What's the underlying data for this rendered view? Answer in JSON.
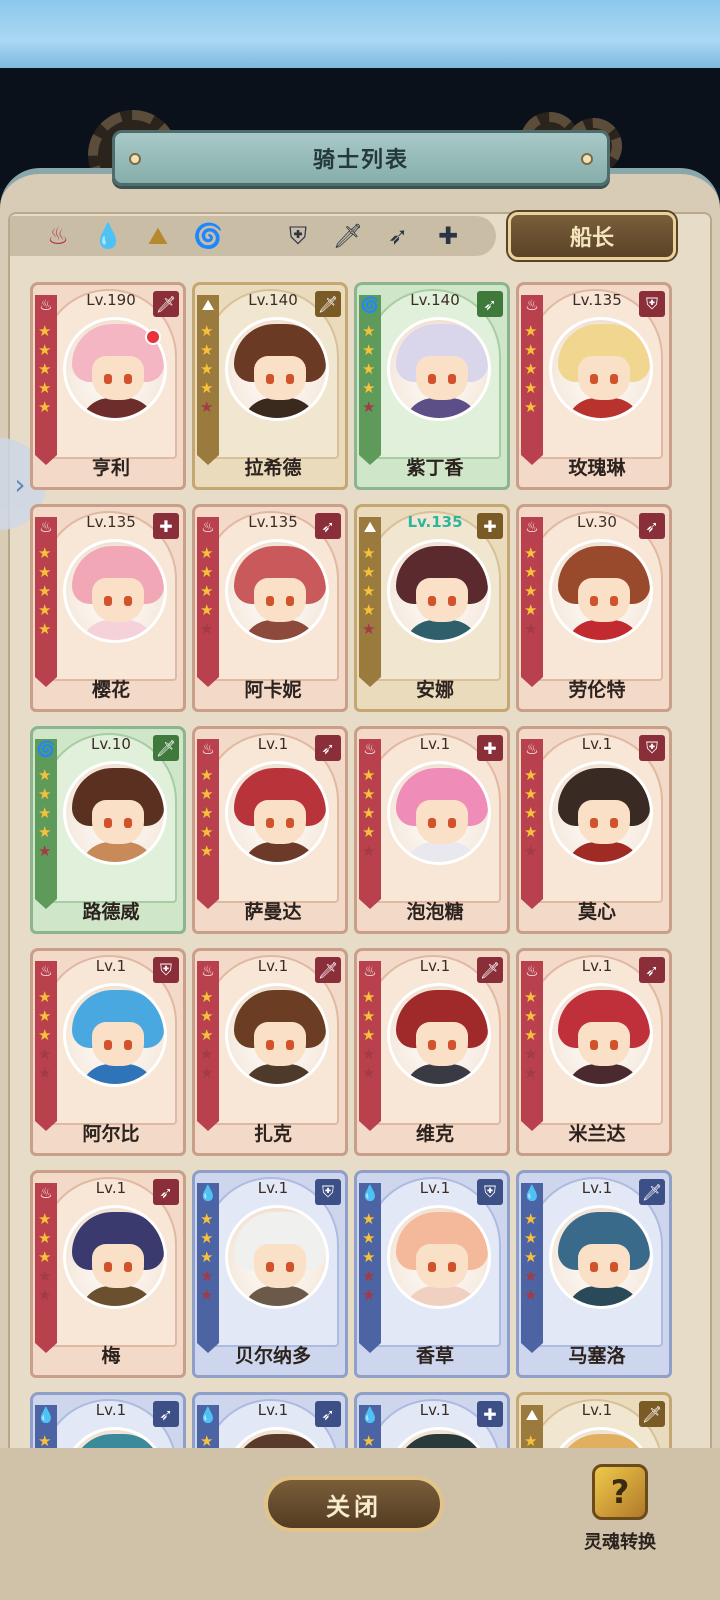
{
  "title": "骑士列表",
  "captain_label": "船长",
  "close_label": "关闭",
  "soul_label": "灵魂转换",
  "filters": {
    "elements": [
      {
        "name": "fire",
        "icon": "fire-icon",
        "glyph": "♨",
        "color": "#b0324a"
      },
      {
        "name": "water",
        "icon": "water-drop-icon",
        "glyph": "💧",
        "color": "#3c6fb5"
      },
      {
        "name": "earth",
        "icon": "earth-icon",
        "glyph": "⛰",
        "color": "#b58a2e"
      },
      {
        "name": "wind",
        "icon": "wind-icon",
        "glyph": "🌀",
        "color": "#7fae3a"
      }
    ],
    "classes": [
      {
        "name": "shield",
        "icon": "shield-icon",
        "glyph": "⛨"
      },
      {
        "name": "sword",
        "icon": "sword-icon",
        "glyph": "🗡"
      },
      {
        "name": "bow",
        "icon": "bow-icon",
        "glyph": "➶"
      },
      {
        "name": "healer",
        "icon": "plus-icon",
        "glyph": "✚"
      }
    ]
  },
  "knights": [
    {
      "name": "亨利",
      "level": "Lv.190",
      "element": "fire",
      "cls": "sword",
      "stars": 5,
      "hair": "#f3b6c2",
      "body": "#6d2d2a",
      "notify": true
    },
    {
      "name": "拉希德",
      "level": "Lv.140",
      "element": "earth",
      "cls": "sword",
      "stars": 4,
      "hair": "#6b3a24",
      "body": "#3a2a1e"
    },
    {
      "name": "紫丁香",
      "level": "Lv.140",
      "element": "wind",
      "cls": "bow",
      "stars": 4,
      "hair": "#d9d6ec",
      "body": "#5c4e86"
    },
    {
      "name": "玫瑰琳",
      "level": "Lv.135",
      "element": "fire",
      "cls": "shield",
      "stars": 5,
      "hair": "#f0d68e",
      "body": "#b8322e"
    },
    {
      "name": "樱花",
      "level": "Lv.135",
      "element": "fire",
      "cls": "healer",
      "stars": 5,
      "hair": "#f2a7b6",
      "body": "#f5d2da"
    },
    {
      "name": "阿卡妮",
      "level": "Lv.135",
      "element": "fire",
      "cls": "bow",
      "stars": 4,
      "hair": "#c9595a",
      "body": "#8d4a3c"
    },
    {
      "name": "安娜",
      "level": "Lv.135",
      "element": "earth",
      "cls": "healer",
      "stars": 4,
      "hair": "#5a2a2e",
      "body": "#2f5f6b",
      "highlight": true
    },
    {
      "name": "劳伦特",
      "level": "Lv.30",
      "element": "fire",
      "cls": "bow",
      "stars": 4,
      "hair": "#9a4a2c",
      "body": "#c12a2e"
    },
    {
      "name": "路德威",
      "level": "Lv.10",
      "element": "wind",
      "cls": "sword",
      "stars": 4,
      "hair": "#5a3020",
      "body": "#c98a5a"
    },
    {
      "name": "萨曼达",
      "level": "Lv.1",
      "element": "fire",
      "cls": "bow",
      "stars": 5,
      "hair": "#b8343a",
      "body": "#6d3a2a"
    },
    {
      "name": "泡泡糖",
      "level": "Lv.1",
      "element": "fire",
      "cls": "healer",
      "stars": 4,
      "hair": "#f08cb8",
      "body": "#e8e8ee"
    },
    {
      "name": "莫心",
      "level": "Lv.1",
      "element": "fire",
      "cls": "shield",
      "stars": 4,
      "hair": "#3a2a24",
      "body": "#a02a24"
    },
    {
      "name": "阿尔比",
      "level": "Lv.1",
      "element": "fire",
      "cls": "shield",
      "stars": 3,
      "hair": "#4aa8e0",
      "body": "#2f74b8"
    },
    {
      "name": "扎克",
      "level": "Lv.1",
      "element": "fire",
      "cls": "sword",
      "stars": 3,
      "hair": "#6b3e24",
      "body": "#4e3a2a"
    },
    {
      "name": "维克",
      "level": "Lv.1",
      "element": "fire",
      "cls": "sword",
      "stars": 3,
      "hair": "#a02a2a",
      "body": "#3a3a44"
    },
    {
      "name": "米兰达",
      "level": "Lv.1",
      "element": "fire",
      "cls": "bow",
      "stars": 3,
      "hair": "#c0303a",
      "body": "#4a2a2e"
    },
    {
      "name": "梅",
      "level": "Lv.1",
      "element": "fire",
      "cls": "bow",
      "stars": 3,
      "hair": "#3a3a6e",
      "body": "#6b5030"
    },
    {
      "name": "贝尔纳多",
      "level": "Lv.1",
      "element": "water",
      "cls": "shield",
      "stars": 3,
      "hair": "#f0f0ee",
      "body": "#6b5a4a"
    },
    {
      "name": "香草",
      "level": "Lv.1",
      "element": "water",
      "cls": "shield",
      "stars": 3,
      "hair": "#f4b89a",
      "body": "#f0d0c0"
    },
    {
      "name": "马塞洛",
      "level": "Lv.1",
      "element": "water",
      "cls": "sword",
      "stars": 3,
      "hair": "#3a6a8a",
      "body": "#2a4a5a"
    },
    {
      "name": "",
      "level": "Lv.1",
      "element": "water",
      "cls": "bow",
      "stars": 3,
      "hair": "#3a8a9a",
      "body": "#2a4a5a"
    },
    {
      "name": "",
      "level": "Lv.1",
      "element": "water",
      "cls": "bow",
      "stars": 3,
      "hair": "#5a3a2a",
      "body": "#3a3a3a"
    },
    {
      "name": "",
      "level": "Lv.1",
      "element": "water",
      "cls": "healer",
      "stars": 3,
      "hair": "#2a3a3a",
      "body": "#3a3a3a"
    },
    {
      "name": "",
      "level": "Lv.1",
      "element": "earth",
      "cls": "sword",
      "stars": 3,
      "hair": "#e0b060",
      "body": "#8a6a3a"
    }
  ]
}
